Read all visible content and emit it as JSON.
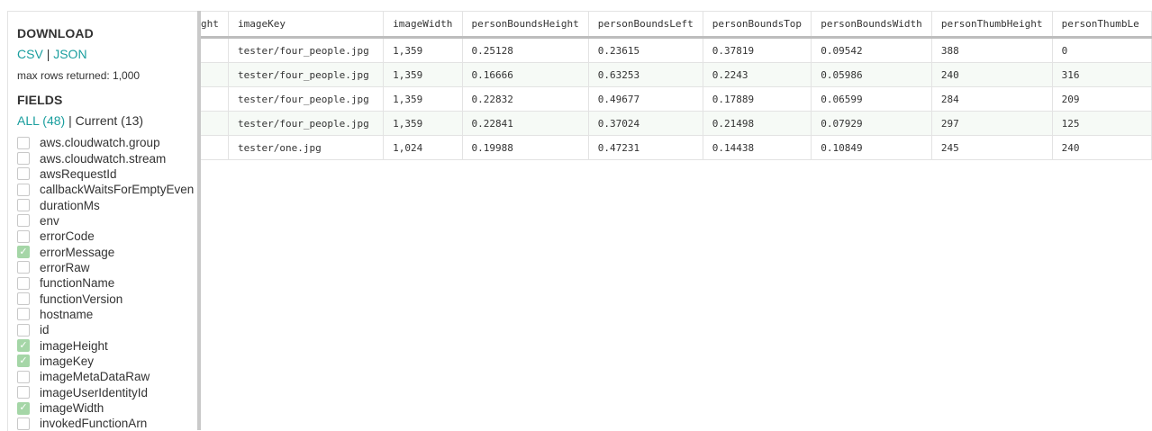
{
  "sidebar": {
    "download_title": "DOWNLOAD",
    "csv_label": "CSV",
    "separator": "|",
    "json_label": "JSON",
    "max_rows": "max rows returned: 1,000",
    "fields_title": "FIELDS",
    "all_tab": "ALL (48)",
    "tab_separator": "|",
    "current_tab": "Current (13)",
    "fields": [
      {
        "label": "aws.cloudwatch.group",
        "checked": false
      },
      {
        "label": "aws.cloudwatch.stream",
        "checked": false
      },
      {
        "label": "awsRequestId",
        "checked": false
      },
      {
        "label": "callbackWaitsForEmptyEven",
        "checked": false
      },
      {
        "label": "durationMs",
        "checked": false
      },
      {
        "label": "env",
        "checked": false
      },
      {
        "label": "errorCode",
        "checked": false
      },
      {
        "label": "errorMessage",
        "checked": true
      },
      {
        "label": "errorRaw",
        "checked": false
      },
      {
        "label": "functionName",
        "checked": false
      },
      {
        "label": "functionVersion",
        "checked": false
      },
      {
        "label": "hostname",
        "checked": false
      },
      {
        "label": "id",
        "checked": false
      },
      {
        "label": "imageHeight",
        "checked": true
      },
      {
        "label": "imageKey",
        "checked": true
      },
      {
        "label": "imageMetaDataRaw",
        "checked": false
      },
      {
        "label": "imageUserIdentityId",
        "checked": false
      },
      {
        "label": "imageWidth",
        "checked": true
      },
      {
        "label": "invokedFunctionArn",
        "checked": false
      }
    ]
  },
  "table": {
    "columns": [
      "ght",
      "imageKey",
      "imageWidth",
      "personBoundsHeight",
      "personBoundsLeft",
      "personBoundsTop",
      "personBoundsWidth",
      "personThumbHeight",
      "personThumbLe"
    ],
    "rows": [
      [
        "",
        "tester/four_people.jpg",
        "1,359",
        "0.25128",
        "0.23615",
        "0.37819",
        "0.09542",
        "388",
        "0"
      ],
      [
        "",
        "tester/four_people.jpg",
        "1,359",
        "0.16666",
        "0.63253",
        "0.2243",
        "0.05986",
        "240",
        "316"
      ],
      [
        "",
        "tester/four_people.jpg",
        "1,359",
        "0.22832",
        "0.49677",
        "0.17889",
        "0.06599",
        "284",
        "209"
      ],
      [
        "",
        "tester/four_people.jpg",
        "1,359",
        "0.22841",
        "0.37024",
        "0.21498",
        "0.07929",
        "297",
        "125"
      ],
      [
        "",
        "tester/one.jpg",
        "1,024",
        "0.19988",
        "0.47231",
        "0.14438",
        "0.10849",
        "245",
        "240"
      ]
    ]
  },
  "colors": {
    "link": "#1a9e9e",
    "checkbox_checked": "#a5d6a7",
    "row_alt": "#f6faf6"
  }
}
